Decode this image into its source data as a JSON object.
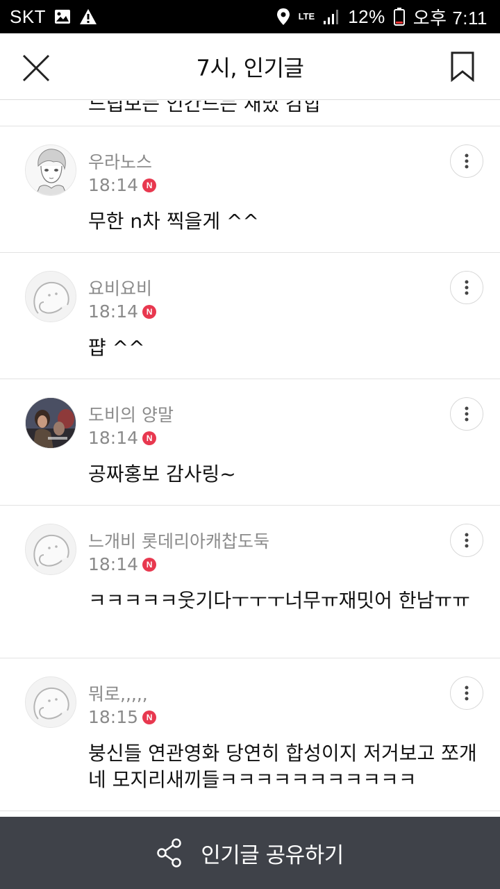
{
  "status_bar": {
    "carrier": "SKT",
    "network": "LTE",
    "battery": "12%",
    "time": "오후 7:11",
    "icons": [
      "image-icon",
      "warning-icon",
      "location-icon",
      "lte-icon",
      "signal-icon",
      "battery-icon"
    ]
  },
  "header": {
    "title": "7시, 인기글",
    "close_icon": "close-icon",
    "bookmark_icon": "bookmark-icon"
  },
  "partial_comment": {
    "body": "드립보는 인간드는 재밌 감합"
  },
  "comments": [
    {
      "name": "우라노스",
      "time": "18:14",
      "badge": "N",
      "body": "무한 n차 찍을게 ^^",
      "avatar": "sketch-portrait"
    },
    {
      "name": "요비요비",
      "time": "18:14",
      "badge": "N",
      "body": "퍕 ^^",
      "avatar": "default-face"
    },
    {
      "name": "도비의 양말",
      "time": "18:14",
      "badge": "N",
      "body": "공짜홍보 감사링~",
      "avatar": "photo"
    },
    {
      "name": "느개비 롯데리아캐찹도둑",
      "time": "18:14",
      "badge": "N",
      "body": "ㅋㅋㅋㅋㅋ웃기다ㅜㅜㅜ너무ㅠ재밋어 한남ㅠㅠ",
      "avatar": "default-face"
    },
    {
      "name": "뭐로,,,,,",
      "time": "18:15",
      "badge": "N",
      "body": "붕신들 연관영화 당연히 합성이지 저거보고 쪼개네 모지리새끼들ㅋㅋㅋㅋㅋㅋㅋㅋㅋㅋㅋ",
      "avatar": "default-face"
    }
  ],
  "share_bar": {
    "label": "인기글 공유하기",
    "icon": "share-icon"
  },
  "colors": {
    "badge": "#e8384f",
    "share_bar": "#3f4249",
    "meta_text": "#8a8a8a"
  }
}
